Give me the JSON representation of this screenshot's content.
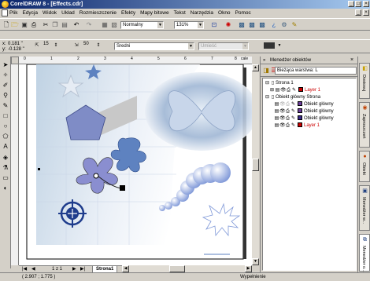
{
  "window": {
    "title": "CorelDRAW 8 - [Effects.cdr]",
    "min": "_",
    "max": "□",
    "close": "×"
  },
  "menu": [
    "Plik",
    "Edycja",
    "Widok",
    "Układ",
    "Rozmieszczenie",
    "Efekty",
    "Mapy bitowe",
    "Tekst",
    "Narzędzia",
    "Okno",
    "Pomoc"
  ],
  "toolbar": {
    "view_mode": "Normalny",
    "zoom": "131%"
  },
  "propbar": {
    "x": "0.181 \"",
    "y": "-0.128 \"",
    "nudge": "15",
    "size": "50",
    "outline": "Średni",
    "color": "Umieść"
  },
  "ruler": {
    "corner": "cale",
    "top_ticks": [
      "0",
      "1",
      "2",
      "3",
      "4",
      "5",
      "6",
      "7",
      "8"
    ]
  },
  "pagenav": {
    "position": "1 z 1",
    "tab": "Strona1"
  },
  "status": {
    "coords": "( 2.907 ; 1.775 )",
    "right": "Wypełnienie"
  },
  "docker": {
    "title": "Menedżer obiektów",
    "layer_label": "Bieżąca warstwa: L",
    "tree": [
      {
        "label": "Strona 1",
        "type": "page"
      },
      {
        "label": "Layer 1",
        "type": "layer",
        "color": "#cc0000",
        "swatch": "#cc0000"
      },
      {
        "label": "Obiekt główny Strona",
        "type": "page"
      },
      {
        "label": "Obiekt główny",
        "type": "master",
        "color": "#000000",
        "swatch": "#6a3d9a"
      },
      {
        "label": "Obiekt główny",
        "type": "master",
        "color": "#000000",
        "swatch": "#6a3d9a"
      },
      {
        "label": "Obiekt główny",
        "type": "master",
        "color": "#000000",
        "swatch": "#3a2a8a"
      },
      {
        "label": "Layer 1",
        "type": "layer",
        "color": "#cc0000",
        "swatch": "#cc0000"
      }
    ]
  },
  "sidetabs": [
    "Dostosuj",
    "Zaproszczeń",
    "Obiekt",
    "Menedżer w...",
    "Menedżer o..."
  ],
  "colors": {
    "titlebar": "#0a246a",
    "accent": "#5a7fc8",
    "layer_red": "#cc0000"
  }
}
